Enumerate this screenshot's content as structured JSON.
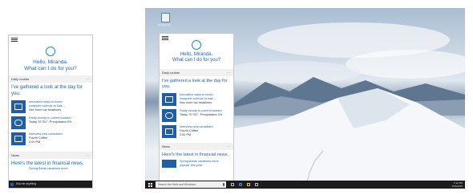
{
  "cortana": {
    "greeting_line1": "Hello, Miranda.",
    "greeting_line2": "What can I do for you?",
    "section_daily": "Daily routine",
    "section_more": "...",
    "look_line": "I've gathered a look at the day for you.",
    "items": [
      {
        "line1": "Innovative ways to teach",
        "line2": "computer science to kids ...",
        "line3": "See more top headlines",
        "icon": "news-icon"
      },
      {
        "line1": "Partly cloudy in current location",
        "line2": "Today 70°/51°, Precipitation 0%",
        "line3": "",
        "icon": "weather-icon"
      },
      {
        "line1": "Interview new consultant",
        "line2": "Fourth Coffee",
        "line3": "2:00 PM",
        "icon": "calendar-icon"
      }
    ],
    "section_news": "News",
    "news_line": "Here's the latest in financial news.",
    "news_item": "Spring Break vacations more",
    "news_item2": "popular this year",
    "search_placeholder": "Ask me anything"
  },
  "desktop": {
    "recycle_bin_label": "Recycle Bin",
    "taskbar_search": "Search the Web and Windows",
    "clock_time": "1:31 PM",
    "clock_date": "2/26/2015"
  },
  "colors": {
    "accent": "#1565c0",
    "tile": "#1f5fa8",
    "taskbar": "#1c1c1c"
  }
}
